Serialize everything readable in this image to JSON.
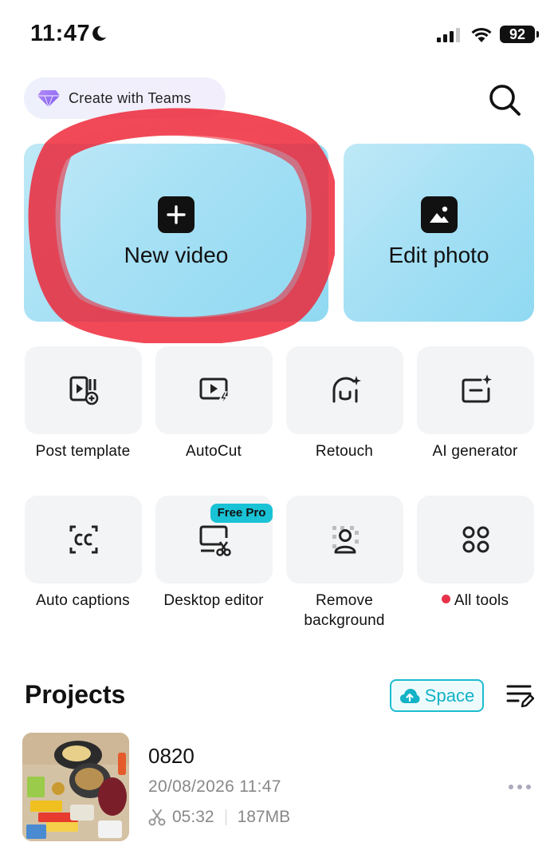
{
  "status_bar": {
    "time": "11:47",
    "battery": "92",
    "icons": [
      "moon-icon",
      "signal-icon",
      "wifi-icon",
      "battery-icon"
    ]
  },
  "header": {
    "teams_label": "Create with Teams",
    "icons": [
      "diamond-icon",
      "search-icon"
    ]
  },
  "hero_cards": [
    {
      "label": "New video",
      "icon": "plus-icon"
    },
    {
      "label": "Edit photo",
      "icon": "image-icon"
    }
  ],
  "tools": [
    {
      "label": "Post template",
      "icon": "post-template-icon"
    },
    {
      "label": "AutoCut",
      "icon": "autocut-icon"
    },
    {
      "label": "Retouch",
      "icon": "retouch-icon"
    },
    {
      "label": "AI generator",
      "icon": "ai-generator-icon"
    },
    {
      "label": "Auto captions",
      "icon": "captions-icon"
    },
    {
      "label": "Desktop editor",
      "icon": "desktop-editor-icon",
      "badge": "Free Pro"
    },
    {
      "label": "Remove background",
      "icon": "remove-background-icon"
    },
    {
      "label": "All tools",
      "icon": "all-tools-icon"
    }
  ],
  "projects": {
    "title": "Projects",
    "space_label": "Space",
    "items": [
      {
        "name": "0820",
        "date": "20/08/2026 11:47",
        "duration": "05:32",
        "size": "187MB"
      }
    ]
  },
  "colors": {
    "hero_gradient_start": "#bfe9f6",
    "hero_gradient_end": "#8fd9f1",
    "accent_cyan": "#19c2d4",
    "tile_bg": "#f3f4f6",
    "annotation_red": "#ee2233",
    "notification_dot": "#e8324a"
  }
}
